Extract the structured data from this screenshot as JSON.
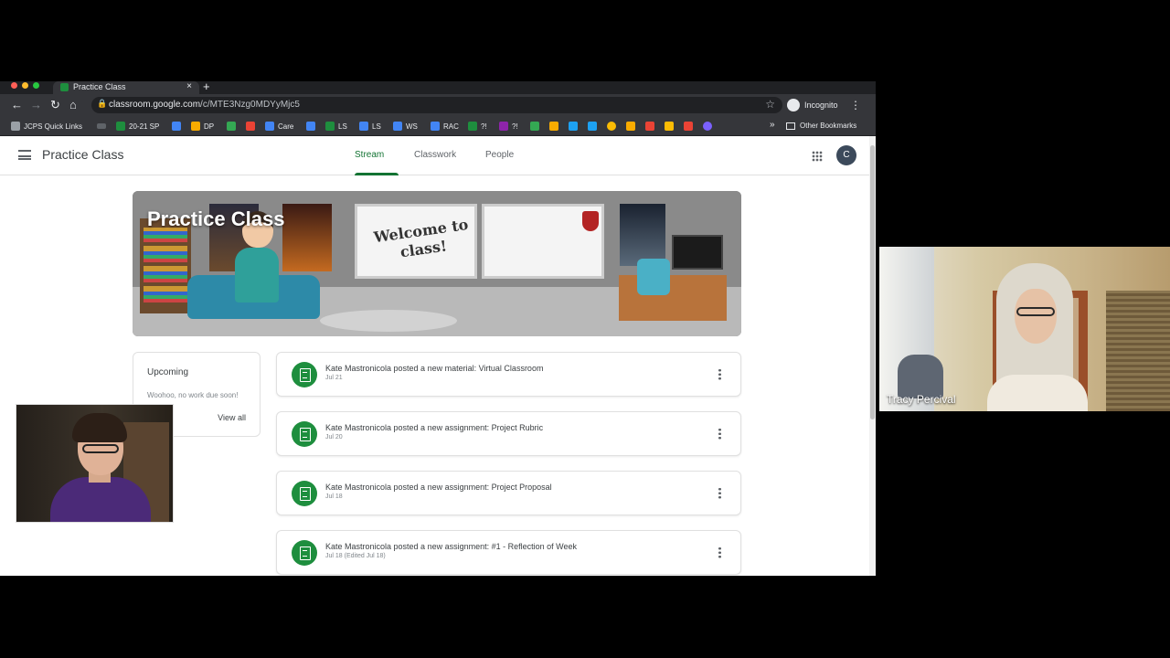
{
  "browser": {
    "tab_title": "Practice Class",
    "url_domain": "classroom.google.com",
    "url_path": "/c/MTE3Nzg0MDYyMjc5",
    "profile_label": "Incognito",
    "bookmarks": [
      {
        "label": "JCPS Quick Links",
        "color": "#9aa0a6"
      },
      {
        "label": "20-21 SP",
        "color": "#1e8e3e"
      },
      {
        "label": "DP",
        "color": "#f9ab00"
      },
      {
        "label": "Care",
        "color": "#4285f4"
      },
      {
        "label": "LS",
        "color": "#1e8e3e"
      },
      {
        "label": "LS",
        "color": "#4285f4"
      },
      {
        "label": "WS",
        "color": "#4285f4"
      },
      {
        "label": "RAC",
        "color": "#4285f4"
      },
      {
        "label": "?!",
        "color": "#1e8e3e"
      },
      {
        "label": "?!",
        "color": "#8e24aa"
      }
    ],
    "other_bookmarks": "Other Bookmarks"
  },
  "classroom": {
    "class_name": "Practice Class",
    "tabs": [
      "Stream",
      "Classwork",
      "People"
    ],
    "active_tab": "Stream",
    "avatar_letter": "C",
    "banner_title": "Practice Class",
    "banner_board_text": "Welcome to class!",
    "upcoming": {
      "heading": "Upcoming",
      "message": "Woohoo, no work due soon!",
      "view_all": "View all"
    },
    "posts": [
      {
        "text": "Kate Mastronicola posted a new material: Virtual Classroom",
        "date": "Jul 21"
      },
      {
        "text": "Kate Mastronicola posted a new assignment: Project Rubric",
        "date": "Jul 20"
      },
      {
        "text": "Kate Mastronicola posted a new assignment: Project Proposal",
        "date": "Jul 18"
      },
      {
        "text": "Kate Mastronicola posted a new assignment: #1 - Reflection of Week",
        "date": "Jul 18 (Edited Jul 18)"
      }
    ],
    "accent_color": "#137333"
  },
  "participants": {
    "tile_2_name": "Tracy Percival"
  }
}
